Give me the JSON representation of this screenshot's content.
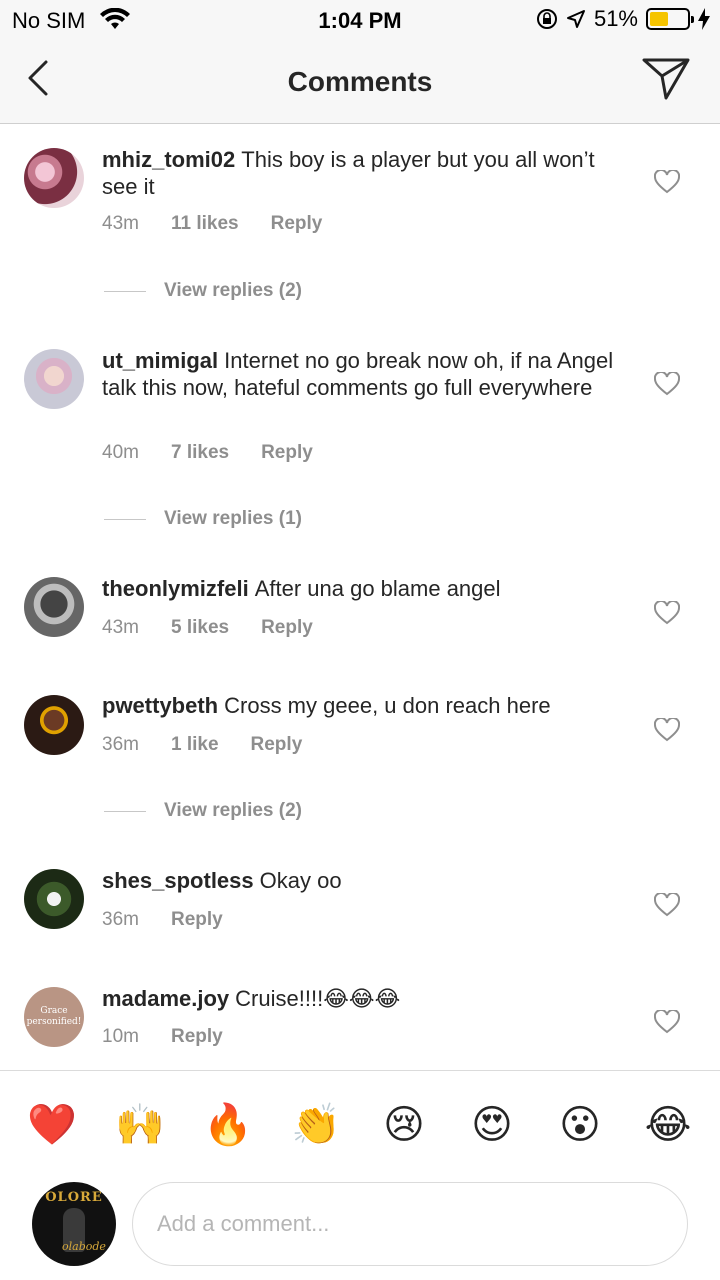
{
  "status_bar": {
    "carrier": "No SIM",
    "time": "1:04 PM",
    "battery": "51%",
    "battery_level": 0.51
  },
  "header": {
    "title": "Comments",
    "back_icon": "chevron-left-icon",
    "send_icon": "paper-plane-icon"
  },
  "comments": [
    {
      "username": "mhiz_tomi02",
      "text": "This boy is a player but you all won’t see it",
      "time": "43m",
      "likes": "11 likes",
      "reply": "Reply",
      "view_replies": "View replies (2)"
    },
    {
      "username": "ut_mimigal",
      "text": "Internet no go break now oh, if na Angel talk this now, hateful comments go full everywhere",
      "time": "40m",
      "likes": "7 likes",
      "reply": "Reply",
      "view_replies": "View replies (1)"
    },
    {
      "username": "theonlymizfeli",
      "text": "After una go blame angel",
      "time": "43m",
      "likes": "5 likes",
      "reply": "Reply"
    },
    {
      "username": "pwettybeth",
      "text": "Cross my geee, u don reach here",
      "time": "36m",
      "likes": "1 like",
      "reply": "Reply",
      "view_replies": "View replies (2)"
    },
    {
      "username": "shes_spotless",
      "text": "Okay oo",
      "time": "36m",
      "reply": "Reply"
    },
    {
      "username": "madame.joy",
      "text": "Cruise!!!!😂😂😂",
      "time": "10m",
      "reply": "Reply",
      "avatar_text": "Grace personified!"
    }
  ],
  "emoji_bar": [
    "❤️",
    "🙌",
    "🔥",
    "👏",
    "😢",
    "😍",
    "😮",
    "😂"
  ],
  "input": {
    "placeholder": "Add a comment...",
    "avatar_text": "OLORE",
    "avatar_signature": "olabode"
  },
  "colors": {
    "text": "#262626",
    "muted": "#8e8e8e",
    "battery": "#f5c400"
  }
}
